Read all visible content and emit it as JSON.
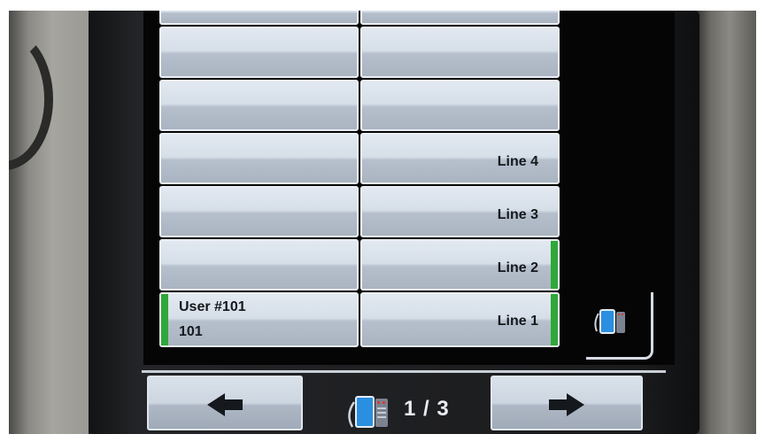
{
  "line_keys": {
    "left_column": [
      {
        "name": "",
        "extension": ""
      },
      {
        "name": "",
        "extension": ""
      },
      {
        "name": "",
        "extension": ""
      },
      {
        "name": "",
        "extension": ""
      },
      {
        "name": "",
        "extension": ""
      },
      {
        "name": "",
        "extension": ""
      },
      {
        "name": "User #101",
        "extension": "101",
        "active": true
      }
    ],
    "right_column": [
      {
        "label": ""
      },
      {
        "label": ""
      },
      {
        "label": ""
      },
      {
        "label": "Line 4"
      },
      {
        "label": "Line 3"
      },
      {
        "label": "Line 2",
        "active": true
      },
      {
        "label": "Line 1",
        "active": true
      }
    ]
  },
  "navigation": {
    "page_indicator": "1 / 3",
    "prev_icon": "arrow-left-icon",
    "next_icon": "arrow-right-icon",
    "phone_icon": "desk-phone-icon"
  },
  "colors": {
    "active_indicator": "#2fa83a",
    "key_face": "#d6dee8",
    "screen_background": "#050506"
  }
}
